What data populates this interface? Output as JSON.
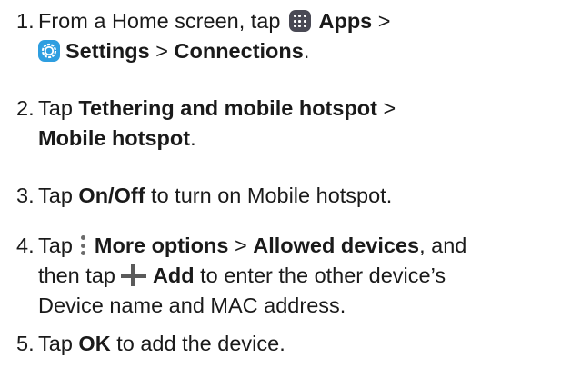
{
  "steps": [
    {
      "number": "1.",
      "parts": {
        "a": "From a Home screen, tap",
        "apps": "Apps",
        "sep1": ">",
        "settings": "Settings",
        "sep2": ">",
        "connections": "Connections",
        "end": "."
      }
    },
    {
      "number": "2.",
      "parts": {
        "a": "Tap",
        "tethering": "Tethering and mobile hotspot",
        "sep1": ">",
        "mobile_hotspot": "Mobile hotspot",
        "end": "."
      }
    },
    {
      "number": "3.",
      "parts": {
        "a": "Tap",
        "onoff": "On/Off",
        "b": "to turn on Mobile hotspot."
      }
    },
    {
      "number": "4.",
      "parts": {
        "a": "Tap",
        "more_options": "More options",
        "sep1": ">",
        "allowed_devices": "Allowed devices",
        "b": ", and",
        "c": "then tap",
        "add": "Add",
        "d": "to enter the other device’s",
        "e": "Device name and MAC address."
      }
    },
    {
      "number": "5.",
      "parts": {
        "a": "Tap",
        "ok": "OK",
        "b": "to add the device."
      }
    }
  ],
  "icons": {
    "apps": "apps-grid-icon",
    "settings": "settings-gear-icon",
    "more": "more-options-icon",
    "add": "add-plus-icon"
  },
  "colors": {
    "text": "#1a1a1a",
    "apps_icon_bg": "#4a4a55",
    "settings_icon_bg": "#2e9ee0",
    "more_icon": "#6b6b6b",
    "add_icon": "#5a5a5a"
  }
}
